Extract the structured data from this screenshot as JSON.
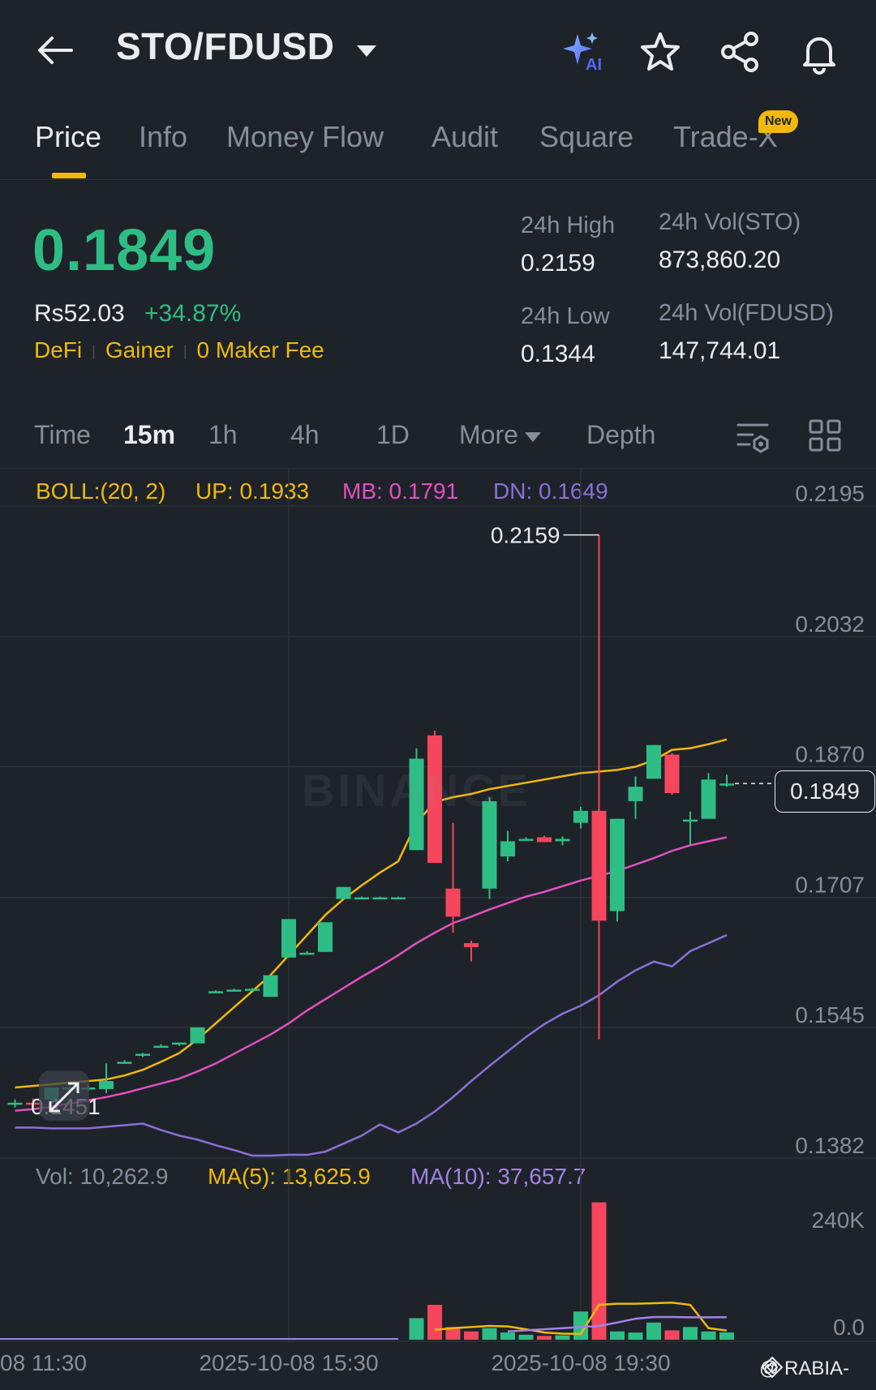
{
  "header": {
    "pair": "STO/FDUSD",
    "icons": [
      "back-arrow-icon",
      "ai-sparkle-icon",
      "star-icon",
      "share-icon",
      "bell-icon"
    ]
  },
  "tabs": [
    {
      "label": "Price",
      "active": true
    },
    {
      "label": "Info"
    },
    {
      "label": "Money Flow"
    },
    {
      "label": "Audit"
    },
    {
      "label": "Square"
    },
    {
      "label": "Trade-X",
      "badge": "New"
    }
  ],
  "price": {
    "last": "0.1849",
    "fiat": "Rs52.03",
    "change": "+34.87%",
    "tags": [
      "DeFi",
      "Gainer",
      "0 Maker Fee"
    ]
  },
  "stats": {
    "high_label": "24h High",
    "high": "0.2159",
    "low_label": "24h Low",
    "low": "0.1344",
    "vol_base_label": "24h Vol(STO)",
    "vol_base": "873,860.20",
    "vol_quote_label": "24h Vol(FDUSD)",
    "vol_quote": "147,744.01"
  },
  "intervals": {
    "items": [
      "Time",
      "15m",
      "1h",
      "4h",
      "1D",
      "More",
      "Depth"
    ],
    "active": "15m"
  },
  "indicators": {
    "boll": "BOLL:(20, 2)",
    "up": "UP: 0.1933",
    "mb": "MB: 0.1791",
    "dn": "DN: 0.1649",
    "vol": "Vol: 10,262.9",
    "ma5": "MA(5): 13,625.9",
    "ma10": "MA(10): 37,657.7"
  },
  "chart_data": {
    "type": "candlestick",
    "price_axis_ticks": [
      "0.2195",
      "0.2032",
      "0.1870",
      "0.1707",
      "0.1545",
      "0.1382"
    ],
    "volume_axis_ticks": [
      "240K",
      "0.0"
    ],
    "x_tick_labels": [
      "08 11:30",
      "2025-10-08 15:30",
      "2025-10-08 19:30"
    ],
    "high_marker": "0.2159",
    "low_marker": "0.1451",
    "last_price": "0.1849",
    "candles": [
      {
        "o": 0.1451,
        "h": 0.1455,
        "l": 0.1445,
        "c": 0.1451
      },
      {
        "o": 0.1451,
        "h": 0.1456,
        "l": 0.1446,
        "c": 0.1449
      },
      {
        "o": 0.1455,
        "h": 0.147,
        "l": 0.1452,
        "c": 0.147
      },
      {
        "o": 0.1468,
        "h": 0.1472,
        "l": 0.1462,
        "c": 0.147
      },
      {
        "o": 0.147,
        "h": 0.1474,
        "l": 0.1466,
        "c": 0.147
      },
      {
        "o": 0.1468,
        "h": 0.15,
        "l": 0.1463,
        "c": 0.1478
      },
      {
        "o": 0.1502,
        "h": 0.1504,
        "l": 0.15,
        "c": 0.1502
      },
      {
        "o": 0.151,
        "h": 0.1513,
        "l": 0.1508,
        "c": 0.1512
      },
      {
        "o": 0.1522,
        "h": 0.1524,
        "l": 0.152,
        "c": 0.1522
      },
      {
        "o": 0.1524,
        "h": 0.1526,
        "l": 0.1522,
        "c": 0.1526
      },
      {
        "o": 0.1525,
        "h": 0.1545,
        "l": 0.1525,
        "c": 0.1545
      },
      {
        "o": 0.159,
        "h": 0.1591,
        "l": 0.1589,
        "c": 0.159
      },
      {
        "o": 0.1592,
        "h": 0.1593,
        "l": 0.1591,
        "c": 0.1592
      },
      {
        "o": 0.1592,
        "h": 0.1594,
        "l": 0.1591,
        "c": 0.1593
      },
      {
        "o": 0.1583,
        "h": 0.161,
        "l": 0.1583,
        "c": 0.161
      },
      {
        "o": 0.1632,
        "h": 0.168,
        "l": 0.1632,
        "c": 0.168
      },
      {
        "o": 0.1638,
        "h": 0.164,
        "l": 0.1636,
        "c": 0.1638
      },
      {
        "o": 0.1639,
        "h": 0.1676,
        "l": 0.1639,
        "c": 0.1676
      },
      {
        "o": 0.1705,
        "h": 0.172,
        "l": 0.1705,
        "c": 0.172
      },
      {
        "o": 0.1707,
        "h": 0.1708,
        "l": 0.1706,
        "c": 0.1707
      },
      {
        "o": 0.1707,
        "h": 0.1708,
        "l": 0.1706,
        "c": 0.1707
      },
      {
        "o": 0.1707,
        "h": 0.1708,
        "l": 0.1706,
        "c": 0.1707
      },
      {
        "o": 0.1766,
        "h": 0.1893,
        "l": 0.1766,
        "c": 0.188
      },
      {
        "o": 0.1909,
        "h": 0.1915,
        "l": 0.175,
        "c": 0.175
      },
      {
        "o": 0.1718,
        "h": 0.18,
        "l": 0.1663,
        "c": 0.1683
      },
      {
        "o": 0.165,
        "h": 0.1653,
        "l": 0.1627,
        "c": 0.1645
      },
      {
        "o": 0.1718,
        "h": 0.1832,
        "l": 0.1705,
        "c": 0.1827
      },
      {
        "o": 0.1758,
        "h": 0.179,
        "l": 0.1752,
        "c": 0.1777
      },
      {
        "o": 0.178,
        "h": 0.1782,
        "l": 0.1778,
        "c": 0.178
      },
      {
        "o": 0.1782,
        "h": 0.1784,
        "l": 0.1776,
        "c": 0.1776
      },
      {
        "o": 0.1777,
        "h": 0.1783,
        "l": 0.1772,
        "c": 0.178
      },
      {
        "o": 0.18,
        "h": 0.182,
        "l": 0.1793,
        "c": 0.1815
      },
      {
        "o": 0.1815,
        "h": 0.2159,
        "l": 0.153,
        "c": 0.1678
      },
      {
        "o": 0.169,
        "h": 0.1805,
        "l": 0.1677,
        "c": 0.1805
      },
      {
        "o": 0.1827,
        "h": 0.1858,
        "l": 0.1805,
        "c": 0.1845
      },
      {
        "o": 0.1855,
        "h": 0.1897,
        "l": 0.1855,
        "c": 0.1897
      },
      {
        "o": 0.1885,
        "h": 0.1887,
        "l": 0.1835,
        "c": 0.1837
      },
      {
        "o": 0.1803,
        "h": 0.1814,
        "l": 0.1772,
        "c": 0.1804
      },
      {
        "o": 0.1805,
        "h": 0.1862,
        "l": 0.1805,
        "c": 0.1854
      },
      {
        "o": 0.1849,
        "h": 0.186,
        "l": 0.1845,
        "c": 0.1849
      }
    ],
    "boll_up": [
      0.147,
      0.1472,
      0.1474,
      0.1476,
      0.1478,
      0.148,
      0.1485,
      0.1492,
      0.1502,
      0.1513,
      0.153,
      0.155,
      0.157,
      0.159,
      0.161,
      0.1635,
      0.166,
      0.1685,
      0.1705,
      0.1722,
      0.1738,
      0.1752,
      0.18,
      0.1826,
      0.1832,
      0.1836,
      0.1842,
      0.1846,
      0.185,
      0.1854,
      0.1858,
      0.1862,
      0.1864,
      0.1866,
      0.187,
      0.1878,
      0.1891,
      0.1893,
      0.1898,
      0.1904
    ],
    "boll_mb": [
      0.1441,
      0.1443,
      0.1446,
      0.145,
      0.1454,
      0.1458,
      0.1463,
      0.1469,
      0.1475,
      0.1481,
      0.149,
      0.15,
      0.1512,
      0.1524,
      0.1536,
      0.155,
      0.1566,
      0.158,
      0.1594,
      0.1608,
      0.1621,
      0.1635,
      0.165,
      0.1663,
      0.1675,
      0.1683,
      0.1692,
      0.17,
      0.1708,
      0.1714,
      0.1721,
      0.1728,
      0.1734,
      0.174,
      0.1748,
      0.1756,
      0.1765,
      0.1772,
      0.1777,
      0.1782
    ],
    "boll_dn": [
      0.142,
      0.142,
      0.1419,
      0.1419,
      0.1419,
      0.1421,
      0.1423,
      0.1425,
      0.1417,
      0.141,
      0.1405,
      0.1398,
      0.1392,
      0.1385,
      0.1385,
      0.1386,
      0.1386,
      0.139,
      0.14,
      0.141,
      0.1424,
      0.1414,
      0.1425,
      0.144,
      0.1458,
      0.1478,
      0.1497,
      0.1515,
      0.1533,
      0.1549,
      0.1562,
      0.1572,
      0.1585,
      0.1602,
      0.1616,
      0.1627,
      0.1621,
      0.164,
      0.165,
      0.166
    ],
    "volumes": [
      0,
      0,
      0,
      0,
      0,
      0,
      0,
      0,
      0,
      0,
      0,
      0,
      0,
      0,
      0,
      0,
      0,
      0,
      0,
      0,
      0,
      0,
      36000,
      60000,
      20000,
      12000,
      18000,
      10000,
      6000,
      4000,
      5000,
      48000,
      245000,
      12000,
      10000,
      28000,
      14000,
      20000,
      12000,
      10262.9
    ],
    "ma5": [
      0,
      0,
      0,
      0,
      0,
      0,
      0,
      0,
      0,
      0,
      0,
      0,
      0,
      0,
      0,
      0,
      0,
      0,
      0,
      0,
      0,
      0,
      0,
      15000,
      18000,
      20000,
      22000,
      21000,
      16000,
      10000,
      8000,
      7500,
      60000,
      62000,
      62000,
      63000,
      64000,
      60000,
      18000,
      13625.9
    ],
    "ma10": [
      0,
      0,
      0,
      0,
      0,
      0,
      0,
      0,
      0,
      0,
      0,
      0,
      0,
      0,
      0,
      0,
      0,
      0,
      0,
      0,
      0,
      0,
      0,
      0,
      0,
      0,
      0,
      12000,
      14000,
      16000,
      18000,
      20000,
      22000,
      28000,
      35000,
      38000,
      38000,
      37500,
      37500,
      37657.7
    ]
  },
  "colors": {
    "up": "#2ebd85",
    "down": "#f6465d",
    "accent": "#f0b90b",
    "boll_up": "#f0b90b",
    "boll_mb": "#e150c1",
    "boll_dn": "#8c6fd9",
    "ma5": "#f0b90b",
    "ma10": "#a282e8"
  },
  "watermark": "BINANCE",
  "credit": "@ RABIA-"
}
